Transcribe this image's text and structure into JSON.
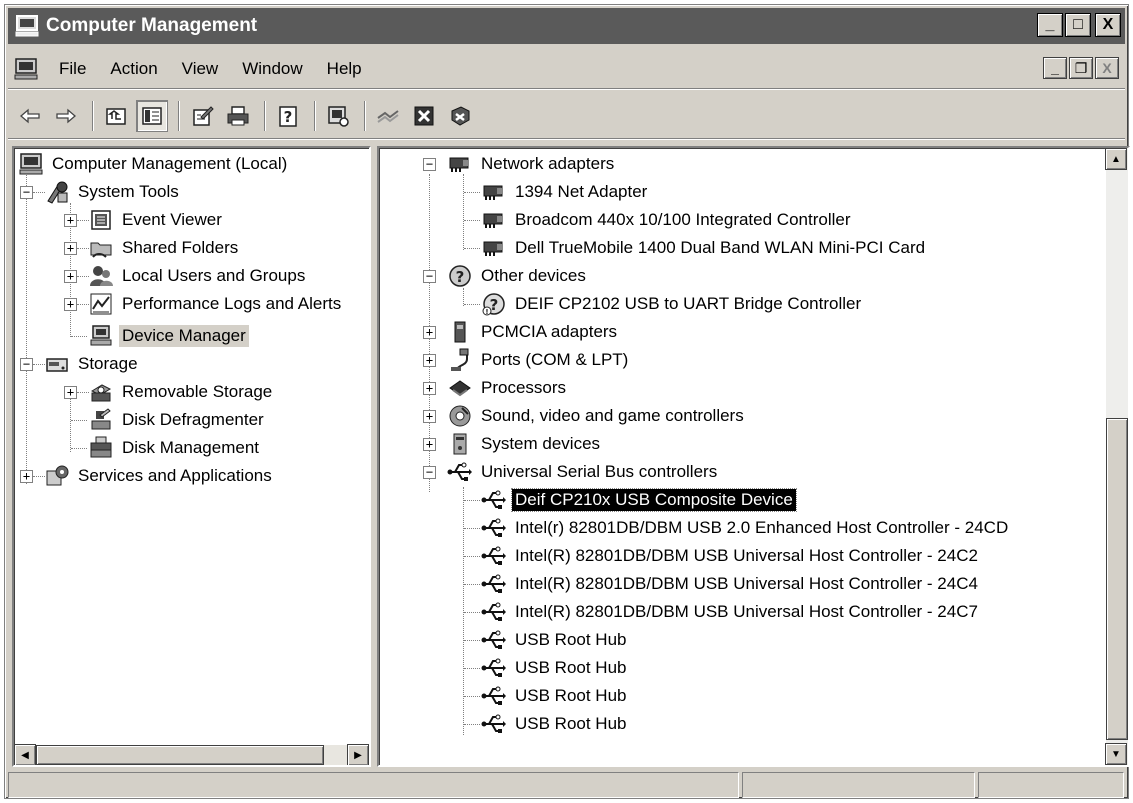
{
  "window": {
    "title": "Computer Management"
  },
  "title_buttons": {
    "minimize": "_",
    "maximize": "□",
    "close": "X"
  },
  "menu": {
    "items": [
      "File",
      "Action",
      "View",
      "Window",
      "Help"
    ],
    "mdi_buttons": {
      "minimize": "_",
      "restore": "❐",
      "close": "X"
    }
  },
  "toolbar": {
    "buttons": [
      "back-icon",
      "forward-icon",
      "up-one-level-icon",
      "show-hide-tree-icon",
      "properties-icon",
      "print-icon",
      "help-icon",
      "scan-hardware-icon",
      "disable-device-icon",
      "uninstall-device-icon",
      "update-driver-icon"
    ]
  },
  "left_tree": {
    "root": "Computer Management (Local)",
    "system_tools": "System Tools",
    "event_viewer": "Event Viewer",
    "shared_folders": "Shared Folders",
    "local_users": "Local Users and Groups",
    "perf_logs": "Performance Logs and Alerts",
    "device_manager": "Device Manager",
    "storage": "Storage",
    "removable_storage": "Removable Storage",
    "disk_defrag": "Disk Defragmenter",
    "disk_management": "Disk Management",
    "services": "Services and Applications",
    "selected": "Device Manager"
  },
  "devices": {
    "network_adapters": "Network adapters",
    "net_1394": "1394 Net Adapter",
    "broadcom": "Broadcom 440x 10/100 Integrated Controller",
    "dell_wlan": "Dell TrueMobile 1400 Dual Band WLAN Mini-PCI Card",
    "other_devices": "Other devices",
    "deif_uart": "DEIF CP2102 USB to UART Bridge Controller",
    "pcmcia": "PCMCIA adapters",
    "ports": "Ports (COM & LPT)",
    "processors": "Processors",
    "sound": "Sound, video and game controllers",
    "system_devices": "System devices",
    "usb_controllers": "Universal Serial Bus controllers",
    "usb_items": [
      "Deif CP210x USB Composite Device",
      "Intel(r) 82801DB/DBM USB 2.0 Enhanced Host Controller - 24CD",
      "Intel(R) 82801DB/DBM USB Universal Host Controller - 24C2",
      "Intel(R) 82801DB/DBM USB Universal Host Controller - 24C4",
      "Intel(R) 82801DB/DBM USB Universal Host Controller - 24C7",
      "USB Root Hub",
      "USB Root Hub",
      "USB Root Hub",
      "USB Root Hub"
    ],
    "selected": "Deif CP210x USB Composite Device"
  },
  "status": [
    "",
    "",
    ""
  ]
}
